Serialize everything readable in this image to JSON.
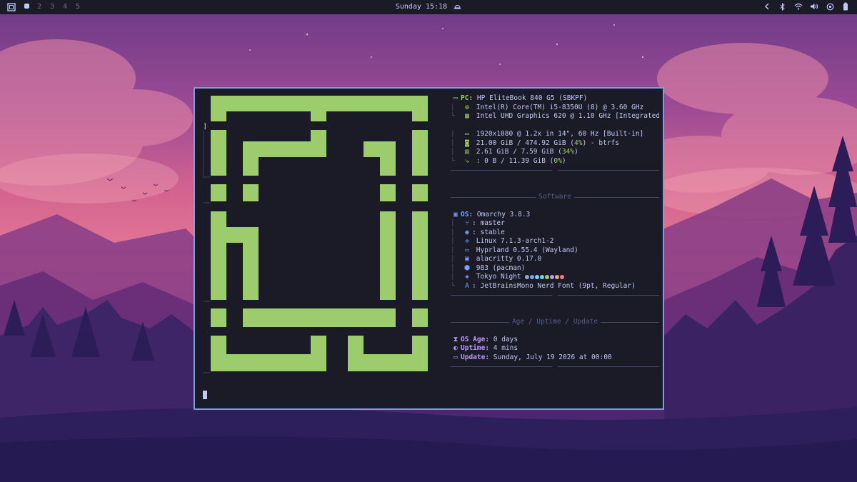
{
  "topbar": {
    "workspaces": [
      "2",
      "3",
      "4",
      "5"
    ],
    "clock": "Sunday 15:18",
    "tray_icons": [
      "chevron-left-icon",
      "bluetooth-icon",
      "wifi-icon",
      "volume-icon",
      "power-profile-icon",
      "battery-icon"
    ]
  },
  "terminal": {
    "prompt_char": "]",
    "hardware": {
      "pc_key": "PC:",
      "pc_value": "HP EliteBook 840 G5 (SBKPF)",
      "cpu": "Intel(R) Core(TM) i5-8350U (8) @ 3.60 GHz",
      "gpu": "Intel UHD Graphics 620 @ 1.10 GHz [Integrated",
      "display": "1920x1080 @ 1.2x in 14\", 60 Hz [Built-in]",
      "disk_a": "21.00 GiB / 474.92 GiB (",
      "disk_pct": "4%",
      "disk_b": ") - btrfs",
      "mem_a": "2.61 GiB / 7.59 GiB (",
      "mem_pct": "34%",
      "mem_b": ")",
      "swap_a": ": 0 B / 11.39 GiB (",
      "swap_pct": "0%",
      "swap_b": ")"
    },
    "software": {
      "title": "Software",
      "os_key": "OS:",
      "os_value": "Omarchy 3.8.3",
      "branch_key": ":",
      "branch": "master",
      "channel_key": ":",
      "channel": "stable",
      "kernel": "Linux 7.1.3-arch1-2",
      "wm": "Hyprland 0.55.4 (Wayland)",
      "terminal": "alacritty 0.17.0",
      "packages": "983 (pacman)",
      "theme": "Tokyo Night",
      "theme_colors": [
        "#9aa5ce",
        "#7aa2f7",
        "#7dcfff",
        "#73daca",
        "#9ece6a",
        "#bb9af7",
        "#e0af68",
        "#f7768e"
      ],
      "font_key": ":",
      "font": "JetBrainsMono Nerd Font (9pt, Regular)"
    },
    "age": {
      "title": "Age / Uptime / Update",
      "os_age_key": "OS Age:",
      "os_age": "0 days",
      "uptime_key": "Uptime:",
      "uptime": "4 mins",
      "update_key": "Update:",
      "update": "Sunday, July 19 2026 at 00:00"
    }
  },
  "colors": {
    "logo_green": "#9ccc6b",
    "terminal_bg": "#1a1b26",
    "terminal_border": "#7aa2d8",
    "key_blue": "#7aa2f7",
    "key_purple": "#bb9af7",
    "key_green": "#9ece6a"
  }
}
